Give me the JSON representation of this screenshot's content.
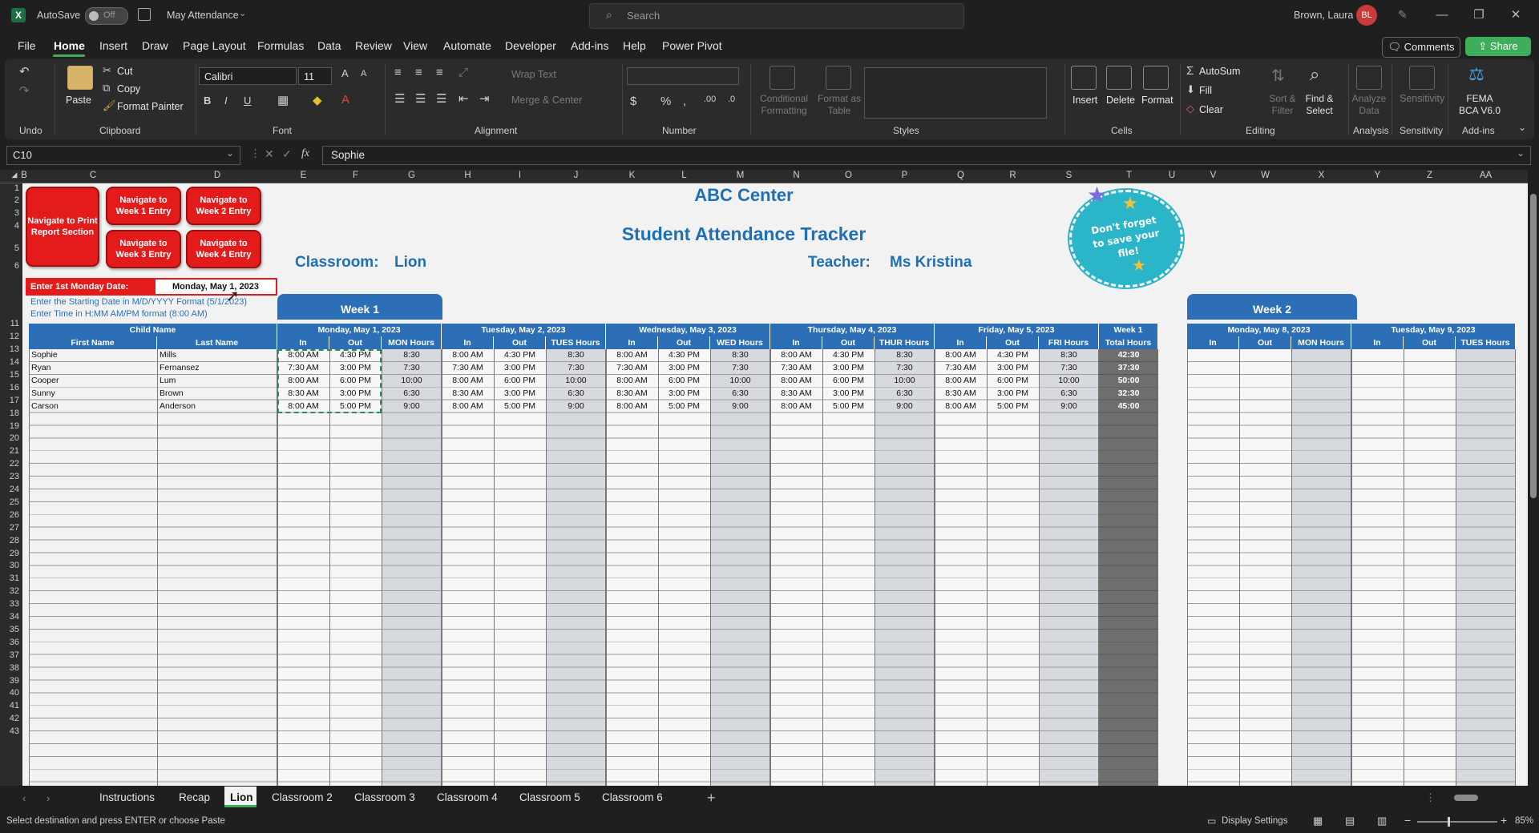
{
  "titlebar": {
    "autosave_label": "AutoSave",
    "autosave_state": "Off",
    "file_name": "May Attendance",
    "search_placeholder": "Search",
    "user_name": "Brown, Laura",
    "user_initials": "BL"
  },
  "menu": [
    "File",
    "Home",
    "Insert",
    "Draw",
    "Page Layout",
    "Formulas",
    "Data",
    "Review",
    "View",
    "Automate",
    "Developer",
    "Add-ins",
    "Help",
    "Power Pivot"
  ],
  "comments_label": "Comments",
  "share_label": "Share",
  "ribbon": {
    "undo_label": "Undo",
    "clipboard": {
      "paste": "Paste",
      "cut": "Cut",
      "copy": "Copy",
      "format_painter": "Format Painter",
      "label": "Clipboard"
    },
    "font": {
      "name": "Calibri",
      "size": "11",
      "label": "Font"
    },
    "alignment": {
      "wrap": "Wrap Text",
      "merge": "Merge & Center",
      "label": "Alignment"
    },
    "number": {
      "label": "Number"
    },
    "styles": {
      "conditional": "Conditional Formatting",
      "format_table": "Format as Table",
      "label": "Styles"
    },
    "cells": {
      "insert": "Insert",
      "delete": "Delete",
      "format": "Format",
      "label": "Cells"
    },
    "editing": {
      "autosum": "AutoSum",
      "fill": "Fill",
      "clear": "Clear",
      "sort": "Sort & Filter",
      "find": "Find & Select",
      "label": "Editing"
    },
    "analysis": {
      "analyze": "Analyze Data",
      "label": "Analysis"
    },
    "sensitivity": {
      "btn": "Sensitivity",
      "label": "Sensitivity"
    },
    "addins": {
      "fema": "FEMA BCA V6.0",
      "label": "Add-ins"
    }
  },
  "formula_bar": {
    "name_box": "C10",
    "formula": "Sophie"
  },
  "columns": [
    "B",
    "C",
    "D",
    "E",
    "F",
    "G",
    "H",
    "I",
    "J",
    "K",
    "L",
    "M",
    "N",
    "O",
    "P",
    "Q",
    "R",
    "S",
    "T",
    "U",
    "V",
    "W",
    "X",
    "Y",
    "Z",
    "AA"
  ],
  "rows": [
    "1",
    "2",
    "3",
    "4",
    "5",
    "6",
    "",
    "",
    "",
    "11",
    "12",
    "13",
    "14",
    "15",
    "16",
    "17",
    "18",
    "19",
    "20",
    "21",
    "22",
    "23",
    "24",
    "25",
    "26",
    "27",
    "28",
    "29",
    "30",
    "31",
    "32",
    "33",
    "34",
    "35",
    "36",
    "37",
    "38",
    "39",
    "40",
    "41",
    "42",
    "43"
  ],
  "sheet": {
    "nav_buttons": {
      "print": "Navigate to Print Report Section",
      "w1": "Navigate to Week 1 Entry",
      "w2": "Navigate to Week 2 Entry",
      "w3": "Navigate to Week 3 Entry",
      "w4": "Navigate to Week 4 Entry"
    },
    "center_name": "ABC Center",
    "tracker_title": "Student Attendance Tracker",
    "classroom_label": "Classroom:",
    "classroom_value": "Lion",
    "teacher_label": "Teacher:",
    "teacher_value": "Ms Kristina",
    "sticker_text": "Don't forget to save your file!",
    "monday_label": "Enter 1st Monday Date:",
    "monday_value": "Monday, May 1, 2023",
    "instr1": "Enter the Starting Date in M/D/YYYY Format (5/1/2023)",
    "instr2": "Enter Time in H:MM AM/PM format (8:00 AM)",
    "week1": "Week 1",
    "week2": "Week 2",
    "child_name": "Child Name",
    "first_name": "First Name",
    "last_name": "Last Name",
    "in": "In",
    "out": "Out",
    "days": [
      {
        "date": "Monday, May 1, 2023",
        "hours": "MON Hours"
      },
      {
        "date": "Tuesday, May 2, 2023",
        "hours": "TUES Hours"
      },
      {
        "date": "Wednesday, May 3, 2023",
        "hours": "WED Hours"
      },
      {
        "date": "Thursday, May 4, 2023",
        "hours": "THUR Hours"
      },
      {
        "date": "Friday, May 5, 2023",
        "hours": "FRI Hours"
      }
    ],
    "week1_total_top": "Week 1",
    "week1_total_bottom": "Total Hours",
    "week2_days": [
      {
        "date": "Monday, May 8, 2023",
        "hours": "MON Hours"
      },
      {
        "date": "Tuesday, May 9, 2023",
        "hours": "TUES Hours"
      }
    ],
    "students": [
      {
        "first": "Sophie",
        "last": "Mills",
        "days": [
          [
            "8:00 AM",
            "4:30 PM",
            "8:30"
          ],
          [
            "8:00 AM",
            "4:30 PM",
            "8:30"
          ],
          [
            "8:00 AM",
            "4:30 PM",
            "8:30"
          ],
          [
            "8:00 AM",
            "4:30 PM",
            "8:30"
          ],
          [
            "8:00 AM",
            "4:30 PM",
            "8:30"
          ]
        ],
        "total": "42:30"
      },
      {
        "first": "Ryan",
        "last": "Fernansez",
        "days": [
          [
            "7:30 AM",
            "3:00 PM",
            "7:30"
          ],
          [
            "7:30 AM",
            "3:00 PM",
            "7:30"
          ],
          [
            "7:30 AM",
            "3:00 PM",
            "7:30"
          ],
          [
            "7:30 AM",
            "3:00 PM",
            "7:30"
          ],
          [
            "7:30 AM",
            "3:00 PM",
            "7:30"
          ]
        ],
        "total": "37:30"
      },
      {
        "first": "Cooper",
        "last": "Lum",
        "days": [
          [
            "8:00 AM",
            "6:00 PM",
            "10:00"
          ],
          [
            "8:00 AM",
            "6:00 PM",
            "10:00"
          ],
          [
            "8:00 AM",
            "6:00 PM",
            "10:00"
          ],
          [
            "8:00 AM",
            "6:00 PM",
            "10:00"
          ],
          [
            "8:00 AM",
            "6:00 PM",
            "10:00"
          ]
        ],
        "total": "50:00"
      },
      {
        "first": "Sunny",
        "last": "Brown",
        "days": [
          [
            "8:30 AM",
            "3:00 PM",
            "6:30"
          ],
          [
            "8:30 AM",
            "3:00 PM",
            "6:30"
          ],
          [
            "8:30 AM",
            "3:00 PM",
            "6:30"
          ],
          [
            "8:30 AM",
            "3:00 PM",
            "6:30"
          ],
          [
            "8:30 AM",
            "3:00 PM",
            "6:30"
          ]
        ],
        "total": "32:30"
      },
      {
        "first": "Carson",
        "last": "Anderson",
        "days": [
          [
            "8:00 AM",
            "5:00 PM",
            "9:00"
          ],
          [
            "8:00 AM",
            "5:00 PM",
            "9:00"
          ],
          [
            "8:00 AM",
            "5:00 PM",
            "9:00"
          ],
          [
            "8:00 AM",
            "5:00 PM",
            "9:00"
          ],
          [
            "8:00 AM",
            "5:00 PM",
            "9:00"
          ]
        ],
        "total": "45:00"
      }
    ]
  },
  "sheet_tabs": [
    "Instructions",
    "Recap",
    "Lion",
    "Classroom 2",
    "Classroom 3",
    "Classroom 4",
    "Classroom 5",
    "Classroom 6"
  ],
  "active_tab": "Lion",
  "status": {
    "message": "Select destination and press ENTER or choose Paste",
    "display_settings": "Display Settings",
    "zoom": "85%"
  }
}
